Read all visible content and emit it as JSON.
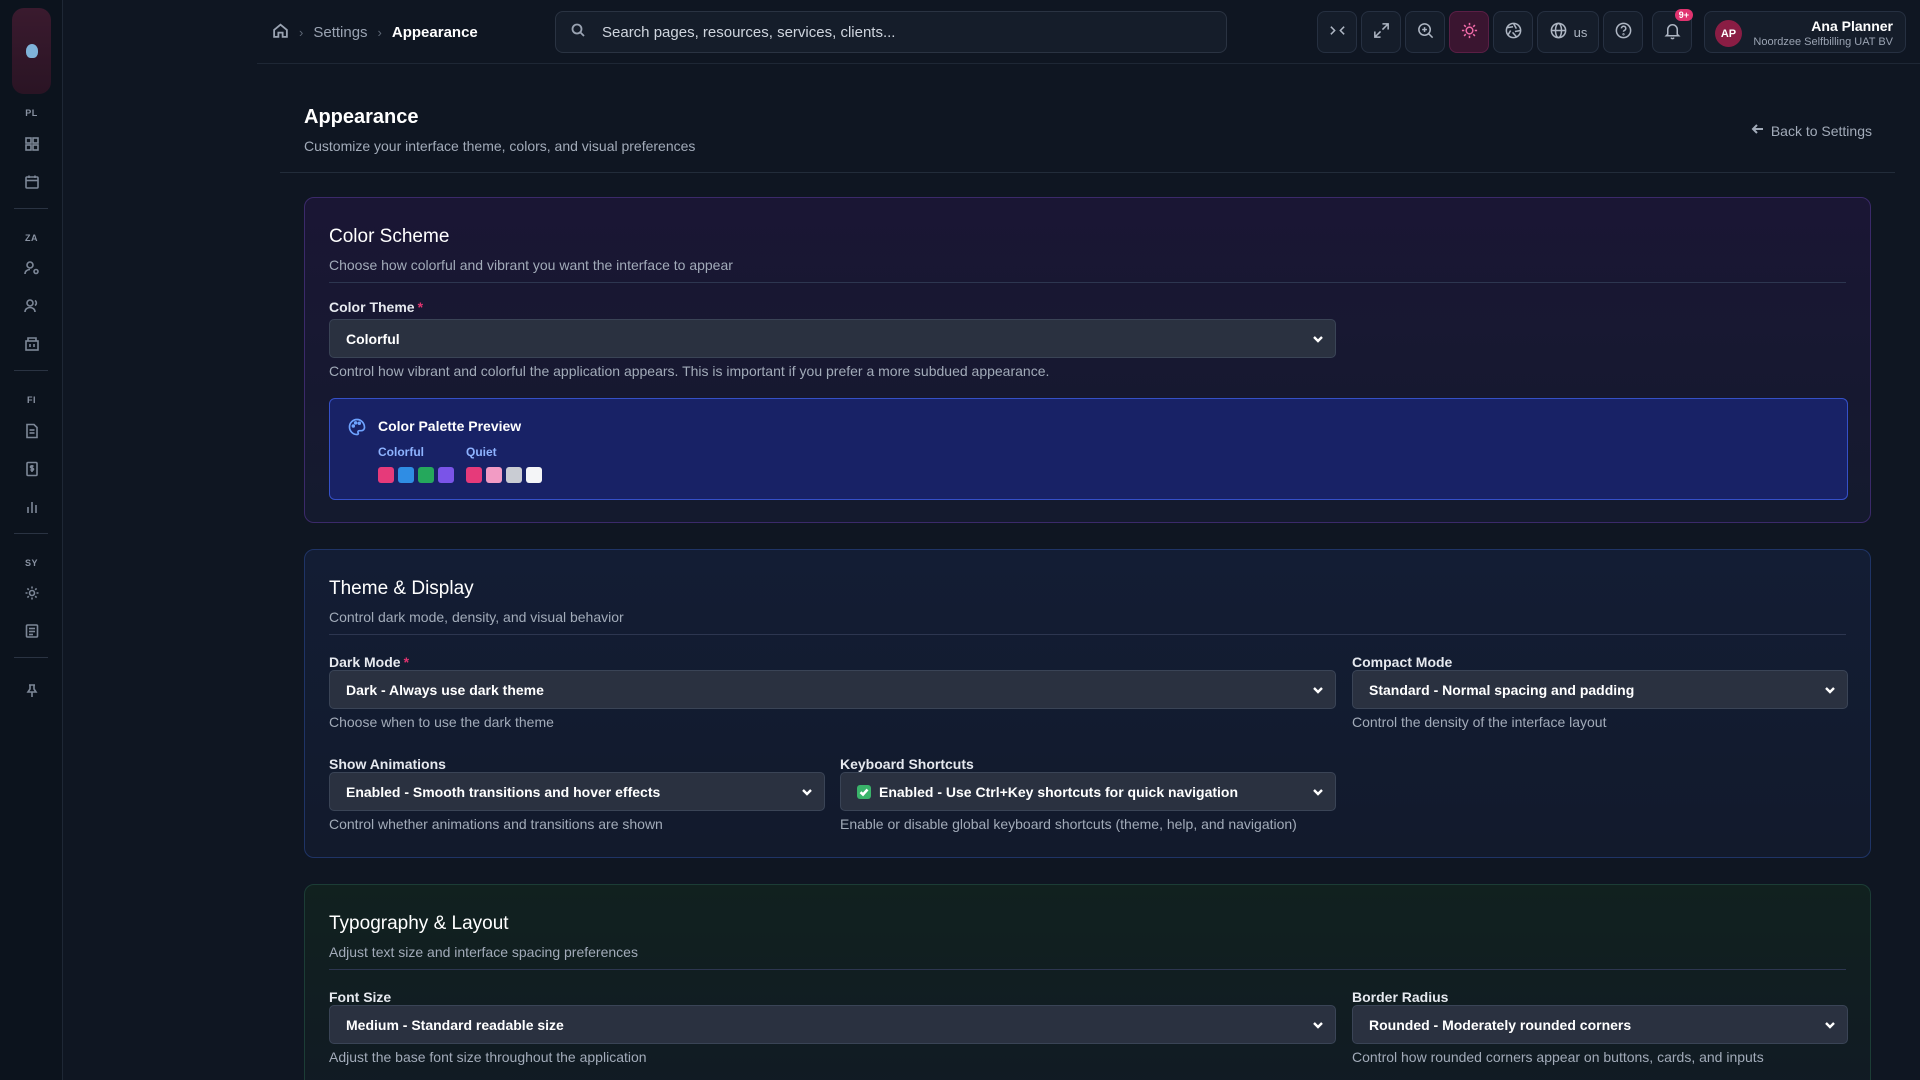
{
  "rail": {
    "sections": [
      "PL",
      "ZA",
      "FI",
      "SY"
    ]
  },
  "breadcrumb": {
    "settings": "Settings",
    "current": "Appearance"
  },
  "search": {
    "placeholder": "Search pages, resources, services, clients..."
  },
  "toolbar": {
    "language": "us",
    "notification_count": "9+"
  },
  "user": {
    "initials": "AP",
    "name": "Ana Planner",
    "org": "Noordzee Selfbilling UAT BV"
  },
  "page": {
    "title": "Appearance",
    "subtitle": "Customize your interface theme, colors, and visual preferences",
    "back_label": "Back to Settings"
  },
  "color_scheme": {
    "title": "Color Scheme",
    "description": "Choose how colorful and vibrant you want the interface to appear",
    "theme_label": "Color Theme",
    "theme_value": "Colorful",
    "theme_help": "Control how vibrant and colorful the application appears. This is important if you prefer a more subdued appearance.",
    "palette": {
      "title": "Color Palette Preview",
      "groups": [
        {
          "label": "Colorful",
          "colors": [
            "#e63a7a",
            "#2f8de4",
            "#25a85c",
            "#7a54e8"
          ]
        },
        {
          "label": "Quiet",
          "colors": [
            "#e63a7a",
            "#f29bc4",
            "#c9ccd3",
            "#f4f5f7"
          ]
        }
      ]
    }
  },
  "theme_display": {
    "title": "Theme & Display",
    "description": "Control dark mode, density, and visual behavior",
    "dark_mode": {
      "label": "Dark Mode",
      "value": "Dark - Always use dark theme",
      "help": "Choose when to use the dark theme"
    },
    "compact_mode": {
      "label": "Compact Mode",
      "value": "Standard - Normal spacing and padding",
      "help": "Control the density of the interface layout"
    },
    "animations": {
      "label": "Show Animations",
      "value": "Enabled - Smooth transitions and hover effects",
      "help": "Control whether animations and transitions are shown"
    },
    "shortcuts": {
      "label": "Keyboard Shortcuts",
      "value": "Enabled - Use Ctrl+Key shortcuts for quick navigation",
      "help": "Enable or disable global keyboard shortcuts (theme, help, and navigation)"
    }
  },
  "typography": {
    "title": "Typography & Layout",
    "description": "Adjust text size and interface spacing preferences",
    "font_size": {
      "label": "Font Size",
      "value": "Medium - Standard readable size",
      "help": "Adjust the base font size throughout the application"
    },
    "border_radius": {
      "label": "Border Radius",
      "value": "Rounded - Moderately rounded corners",
      "help": "Control how rounded corners appear on buttons, cards, and inputs"
    }
  }
}
